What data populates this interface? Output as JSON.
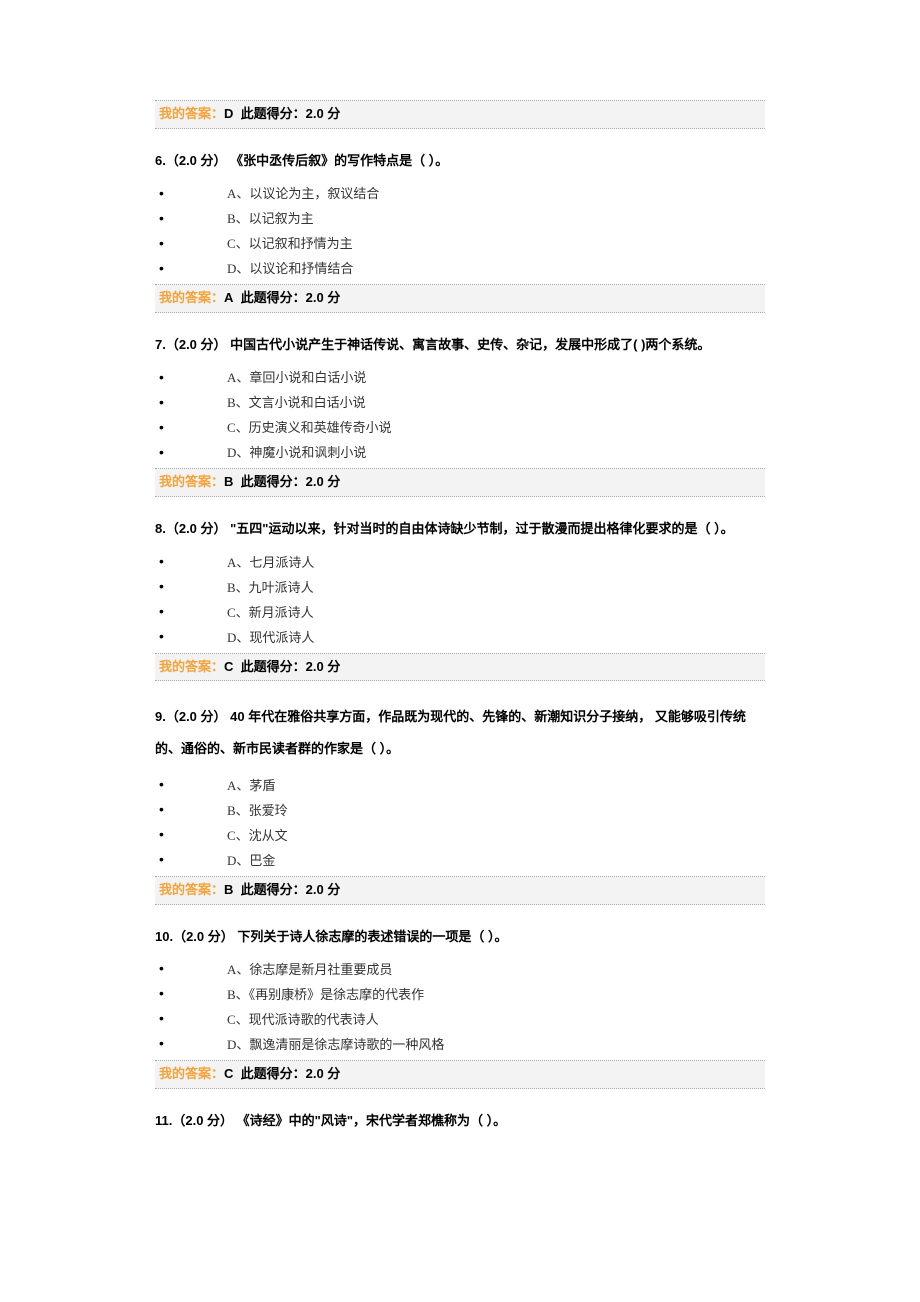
{
  "answer_label": "我的答案：",
  "score_prefix": "此题得分：",
  "score_suffix": " 分",
  "pre_answer": {
    "answer": "D",
    "score": "2.0"
  },
  "questions": [
    {
      "num": "6.",
      "pts": "（2.0 分）",
      "text": " 《张中丞传后叙》的写作特点是（  ）。",
      "options": [
        "A、以议论为主，叙议结合",
        "B、以记叙为主",
        "C、以记叙和抒情为主",
        "D、以议论和抒情结合"
      ],
      "answer": "A",
      "score": "2.0"
    },
    {
      "num": "7.",
      "pts": "（2.0 分）",
      "text": " 中国古代小说产生于神话传说、寓言故事、史传、杂记，发展中形成了( )两个系统。",
      "options": [
        "A、章回小说和白话小说",
        "B、文言小说和白话小说",
        "C、历史演义和英雄传奇小说",
        "D、神魔小说和讽刺小说"
      ],
      "answer": "B",
      "score": "2.0"
    },
    {
      "num": "8.",
      "pts": "（2.0 分）",
      "text": " \"五四\"运动以来，针对当时的自由体诗缺少节制，过于散漫而提出格律化要求的是（  ）。",
      "options": [
        "A、七月派诗人",
        "B、九叶派诗人",
        "C、新月派诗人",
        "D、现代派诗人"
      ],
      "answer": "C",
      "score": "2.0"
    },
    {
      "num": "9.",
      "pts": "（2.0 分）",
      "text": " 40 年代在雅俗共享方面，作品既为现代的、先锋的、新潮知识分子接纳， 又能够吸引传统的、通俗的、新市民读者群的作家是（  ）。",
      "options": [
        "A、茅盾",
        "B、张爱玲",
        "C、沈从文",
        "D、巴金"
      ],
      "answer": "B",
      "score": "2.0"
    },
    {
      "num": "10.",
      "pts": "（2.0 分）",
      "text": " 下列关于诗人徐志摩的表述错误的一项是（  ）。",
      "options": [
        "A、徐志摩是新月社重要成员",
        "B、《再别康桥》是徐志摩的代表作",
        "C、现代派诗歌的代表诗人",
        "D、飘逸清丽是徐志摩诗歌的一种风格"
      ],
      "answer": "C",
      "score": "2.0"
    },
    {
      "num": "11.",
      "pts": "（2.0 分）",
      "text": " 《诗经》中的\"风诗\"，宋代学者郑樵称为（  ）。",
      "options": [],
      "answer": null,
      "score": null
    }
  ]
}
